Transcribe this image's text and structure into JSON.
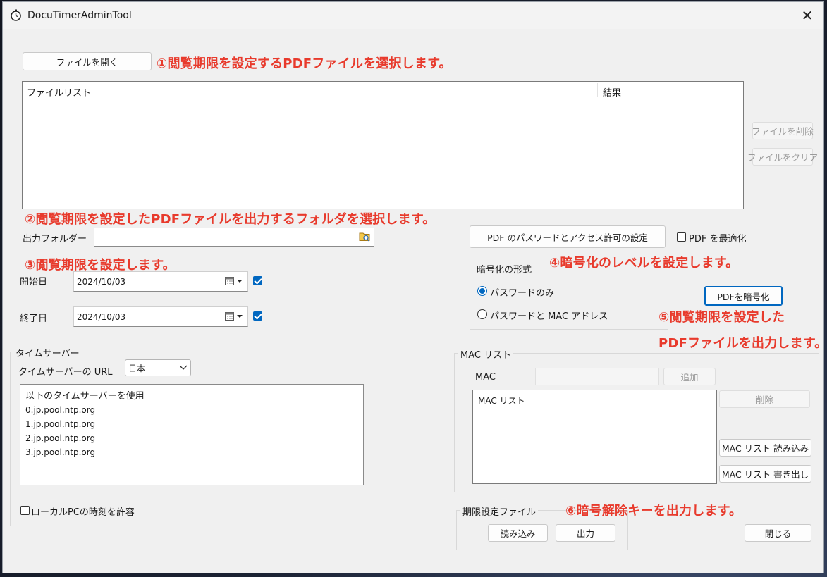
{
  "window": {
    "title": "DocuTimerAdminTool",
    "close_label": "✕"
  },
  "toolbar": {
    "open_file": "ファイルを開く"
  },
  "annotations": {
    "a1": "①閲覧期限を設定するPDFファイルを選択します。",
    "a2": "②閲覧期限を設定したPDFファイルを出力するフォルダを選択します。",
    "a3": "③閲覧期限を設定します。",
    "a4": "④暗号化のレベルを設定します。",
    "a5_line1": "⑤閲覧期限を設定した",
    "a5_line2": "PDFファイルを出力します。",
    "a6": "⑥暗号解除キーを出力します。"
  },
  "file_list": {
    "col_name": "ファイルリスト",
    "col_result": "結果"
  },
  "file_buttons": {
    "delete": "ファイルを削除",
    "clear": "ファイルをクリア"
  },
  "output": {
    "label": "出力フォルダー",
    "value": ""
  },
  "pdf_settings": {
    "password_button": "PDF のパスワードとアクセス許可の設定",
    "optimize_label": "PDF を最適化"
  },
  "dates": {
    "start_label": "開始日",
    "start_value": "2024/10/03",
    "end_label": "終了日",
    "end_value": "2024/10/03"
  },
  "encryption": {
    "group_title": "暗号化の形式",
    "option1": "パスワードのみ",
    "option2": "パスワードと MAC アドレス",
    "encrypt_button": "PDFを暗号化"
  },
  "time_server": {
    "group_title": "タイムサーバー",
    "url_label": "タイムサーバーの URL",
    "region": "日本",
    "list_header": "以下のタイムサーバーを使用",
    "servers": [
      "0.jp.pool.ntp.org",
      "1.jp.pool.ntp.org",
      "2.jp.pool.ntp.org",
      "3.jp.pool.ntp.org"
    ],
    "allow_local": "ローカルPCの時刻を許容"
  },
  "mac": {
    "group_title": "MAC リスト",
    "mac_label": "MAC",
    "add": "追加",
    "list_header": "MAC リスト",
    "delete": "削除",
    "import": "MAC リスト 読み込み",
    "export": "MAC リスト 書き出し"
  },
  "expiry_file": {
    "group_title": "期限設定ファイル",
    "load": "読み込み",
    "output": "出力"
  },
  "footer": {
    "close": "閉じる"
  },
  "colors": {
    "annotation": "#e83a2c",
    "accent": "#0067c0"
  }
}
